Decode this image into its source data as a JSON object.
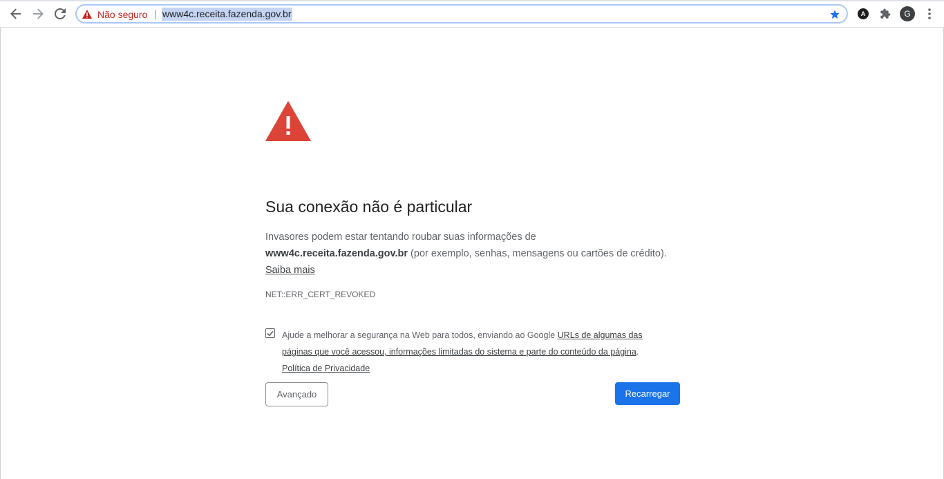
{
  "toolbar": {
    "security_label": "Não seguro",
    "url": "www4c.receita.fazenda.gov.br",
    "profile_initial": "G",
    "extension_letter": "A"
  },
  "icons": {
    "back": "arrow-left-icon",
    "forward": "arrow-right-icon",
    "reload": "reload-icon",
    "security": "warning-triangle-icon",
    "bookmark": "star-icon",
    "extension": "extension-a-icon",
    "extensions_menu": "puzzle-icon",
    "menu": "kebab-menu-icon",
    "page_warning": "warning-triangle-icon"
  },
  "interstitial": {
    "heading": "Sua conexão não é particular",
    "explanation_prefix": "Invasores podem estar tentando roubar suas informações de ",
    "domain": "www4c.receita.fazenda.gov.br",
    "explanation_suffix": " (por exemplo, senhas, mensagens ou cartões de crédito).",
    "learn_more": "Saiba mais",
    "error_code": "NET::ERR_CERT_REVOKED",
    "checkbox_checked": true,
    "checkbox_text_prefix": "Ajude a melhorar a segurança na Web para todos, enviando ao Google ",
    "checkbox_link": "URLs de algumas das páginas que você acessou, informações limitadas do sistema e parte do conteúdo da página",
    "checkbox_text_suffix": ".",
    "privacy_link": "Política de Privacidade",
    "advanced_button": "Avançado",
    "reload_button": "Recarregar"
  },
  "colors": {
    "danger": "#c5221f",
    "warning_triangle": "#db4437",
    "primary_button": "#1a73e8",
    "star": "#1a73e8"
  }
}
